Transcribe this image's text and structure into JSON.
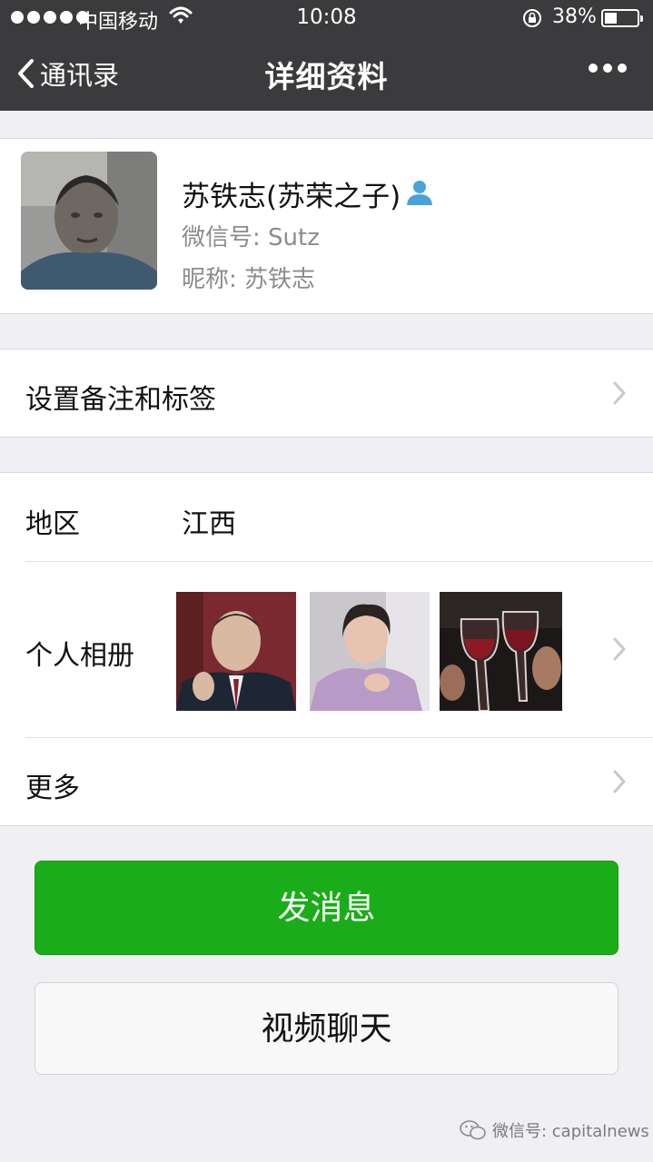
{
  "status_bar": {
    "carrier": "中国移动",
    "time": "10:08",
    "battery_percent": "38%",
    "battery_level": 0.38,
    "icons": [
      "signal-dots-icon",
      "wifi-icon",
      "rotation-lock-icon",
      "battery-icon"
    ]
  },
  "nav": {
    "back_label": "通讯录",
    "title": "详细资料",
    "more_icon": "more-dots-icon"
  },
  "profile": {
    "name": "苏铁志(苏荣之子)",
    "wechat_id": "微信号:  Sutz",
    "nickname": "昵称:  苏铁志",
    "badge_icon": "contact-person-icon"
  },
  "rows": {
    "remark_label": "设置备注和标签",
    "region_label": "地区",
    "region_value": "江西",
    "album_label": "个人相册",
    "more_label": "更多"
  },
  "buttons": {
    "send_message": "发消息",
    "video_chat": "视频聊天"
  },
  "watermark": {
    "text": "微信号: capitalnews"
  },
  "colors": {
    "nav_bg": "#3b3b3d",
    "page_bg": "#efeff4",
    "primary_green": "#1aad19",
    "badge_blue": "#4aa3d8"
  }
}
